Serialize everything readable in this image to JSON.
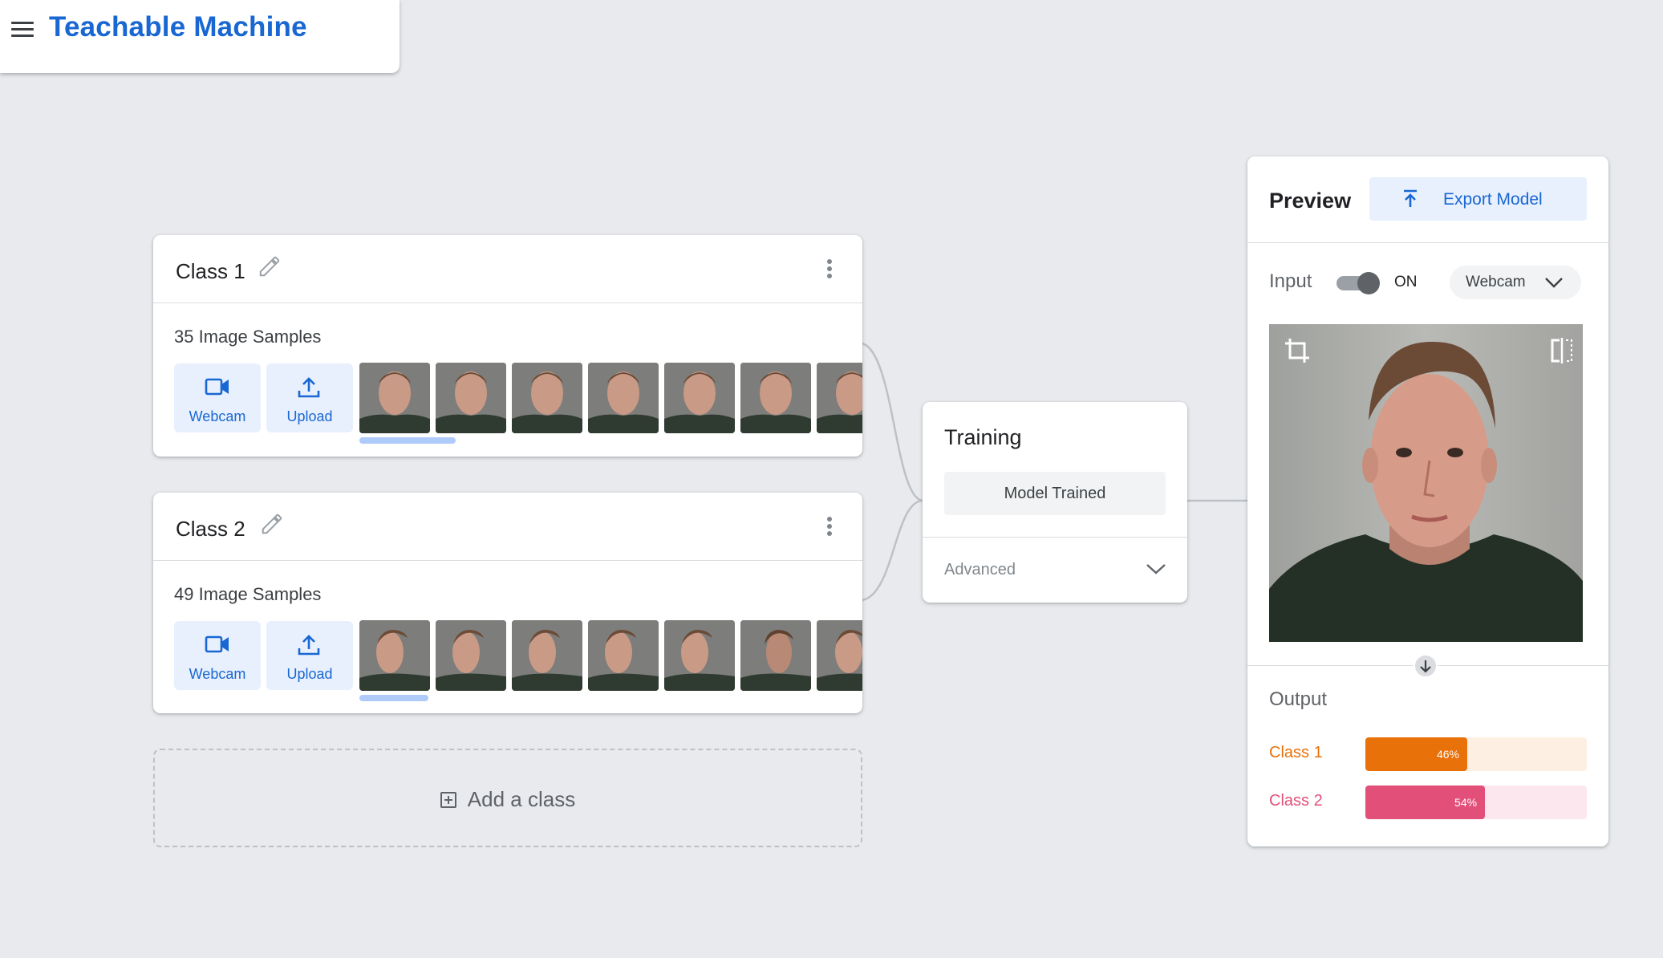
{
  "app": {
    "title": "Teachable Machine"
  },
  "classes": [
    {
      "name": "Class 1",
      "sample_count_label": "35 Image Samples",
      "webcam_label": "Webcam",
      "upload_label": "Upload"
    },
    {
      "name": "Class 2",
      "sample_count_label": "49 Image Samples",
      "webcam_label": "Webcam",
      "upload_label": "Upload"
    }
  ],
  "add_class": {
    "label": "Add a class"
  },
  "training": {
    "title": "Training",
    "button_label": "Model Trained",
    "advanced_label": "Advanced"
  },
  "preview": {
    "title": "Preview",
    "export_label": "Export Model",
    "input_label": "Input",
    "toggle_state": "ON",
    "source_selected": "Webcam",
    "output_label": "Output",
    "outputs": [
      {
        "name": "Class 1",
        "percent_label": "46%",
        "value": 0.46,
        "color": "#e8710a",
        "bg": "#feefe3"
      },
      {
        "name": "Class 2",
        "percent_label": "54%",
        "value": 0.54,
        "color": "#e2507a",
        "bg": "#fde7ee"
      }
    ]
  },
  "colors": {
    "accent": "#1967d2",
    "background": "#e8eaed"
  }
}
